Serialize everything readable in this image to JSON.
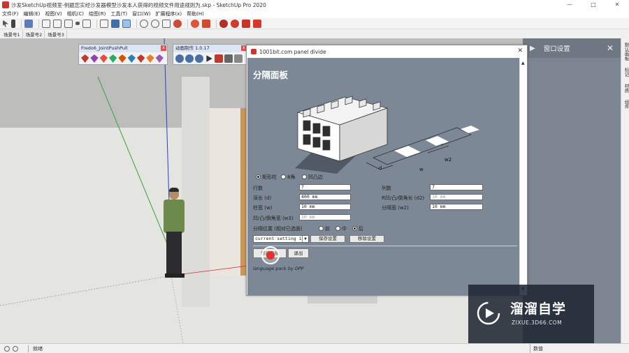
{
  "window": {
    "title": "沙发SketchUp视频室-例题您实经沙发器模型沙发本人获得的视频文件用途规则为.skp - SketchUp Pro 2020",
    "controls": [
      "—",
      "□",
      "✕"
    ]
  },
  "menu": [
    "文件(F)",
    "编辑(E)",
    "视图(V)",
    "相机(C)",
    "绘图(R)",
    "工具(T)",
    "窗口(W)",
    "扩展程序(x)",
    "帮助(H)"
  ],
  "scenes": [
    "场景号1",
    "场景号2",
    "场景号3"
  ],
  "fredo_toolbar": {
    "title": "Fredo6_JointPushPull",
    "close": "x",
    "icon_colors": [
      "#c0392b",
      "#8e44ad",
      "#e74c3c",
      "#27ae60",
      "#d35400",
      "#2980b9",
      "#c0392b",
      "#e67e22",
      "#9b59b6"
    ]
  },
  "second_toolbar": {
    "title": "动画制作 1.0.17",
    "close": "x"
  },
  "dialog": {
    "title": "1001bit.com panel divide",
    "close": "✕",
    "heading": "分隔面板",
    "scroll_up": "▲",
    "scroll_down": "▼",
    "illustration_labels": {
      "d": "d",
      "w": "w",
      "w2": "w2"
    },
    "type_options": [
      {
        "label": "矩形柱",
        "selected": true
      },
      {
        "label": "8角",
        "selected": false
      },
      {
        "label": "凹凸边",
        "selected": false
      }
    ],
    "fields": {
      "rows_label": "行数",
      "rows_value": "7",
      "cols_label": "列数",
      "cols_value": "7",
      "depth_label": "深长 (d)",
      "depth_value": "400 mm",
      "recess_label": "R凹/凸/倒角长 (d2)",
      "recess_value": "10 mm",
      "width_label": "柱宽 (w)",
      "width_value": "10 mm",
      "divwidth_label": "分隔宽 (w2)",
      "divwidth_value": "10 mm",
      "chamfer_label": "凹/凸/倒角宽 (w3)",
      "chamfer_value": "10 mm"
    },
    "position": {
      "label": "分隔位置 (相对已选面)",
      "options": [
        {
          "label": "前",
          "selected": false
        },
        {
          "label": "中",
          "selected": false
        },
        {
          "label": "后",
          "selected": true
        }
      ]
    },
    "preset_select": "current setting 1",
    "preset_arrow": "▼",
    "save_button": "保存设置",
    "delete_button": "移除设置",
    "create_button": "创建面板",
    "exit_button": "退出",
    "credit": "language pack by DPP"
  },
  "tray": {
    "title": "窗口设置",
    "arrow": "▶",
    "close": "✕",
    "side_tabs": [
      "默认面板",
      "标记",
      "材质",
      "组件"
    ]
  },
  "status": {
    "text": "就绪",
    "measure_label": "数值"
  },
  "watermark": {
    "brand": "溜溜自学",
    "url": "ZIXUE.3D66.COM"
  }
}
